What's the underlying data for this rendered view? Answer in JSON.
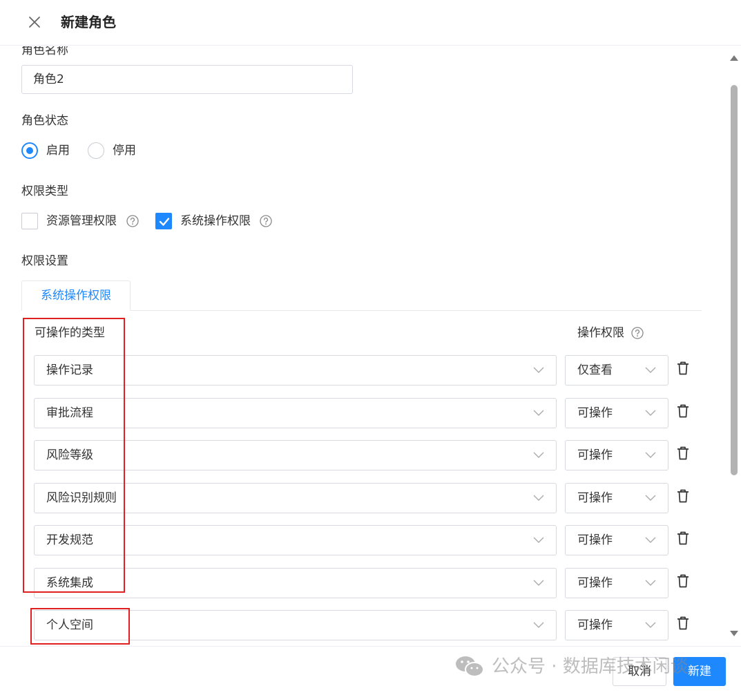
{
  "header": {
    "title": "新建角色"
  },
  "form": {
    "role_name_label": "角色名称",
    "role_name_value": "角色2",
    "role_status_label": "角色状态",
    "status_options": [
      {
        "label": "启用",
        "selected": true
      },
      {
        "label": "停用",
        "selected": false
      }
    ],
    "perm_type_label": "权限类型",
    "perm_types": [
      {
        "label": "资源管理权限",
        "checked": false
      },
      {
        "label": "系统操作权限",
        "checked": true
      }
    ],
    "perm_settings_label": "权限设置"
  },
  "tabs": [
    {
      "label": "系统操作权限",
      "active": true
    }
  ],
  "table": {
    "type_header": "可操作的类型",
    "perm_header": "操作权限",
    "rows": [
      {
        "type": "操作记录",
        "perm": "仅查看"
      },
      {
        "type": "审批流程",
        "perm": "可操作"
      },
      {
        "type": "风险等级",
        "perm": "可操作"
      },
      {
        "type": "风险识别规则",
        "perm": "可操作"
      },
      {
        "type": "开发规范",
        "perm": "可操作"
      },
      {
        "type": "系统集成",
        "perm": "可操作"
      },
      {
        "type": "个人空间",
        "perm": "可操作"
      }
    ]
  },
  "footer": {
    "cancel_label": "取消",
    "create_label": "新建"
  },
  "watermark": {
    "text": "公众号 · 数据库技术闲谈"
  },
  "colors": {
    "primary": "#1e88ff",
    "highlight_border": "#e02020"
  }
}
